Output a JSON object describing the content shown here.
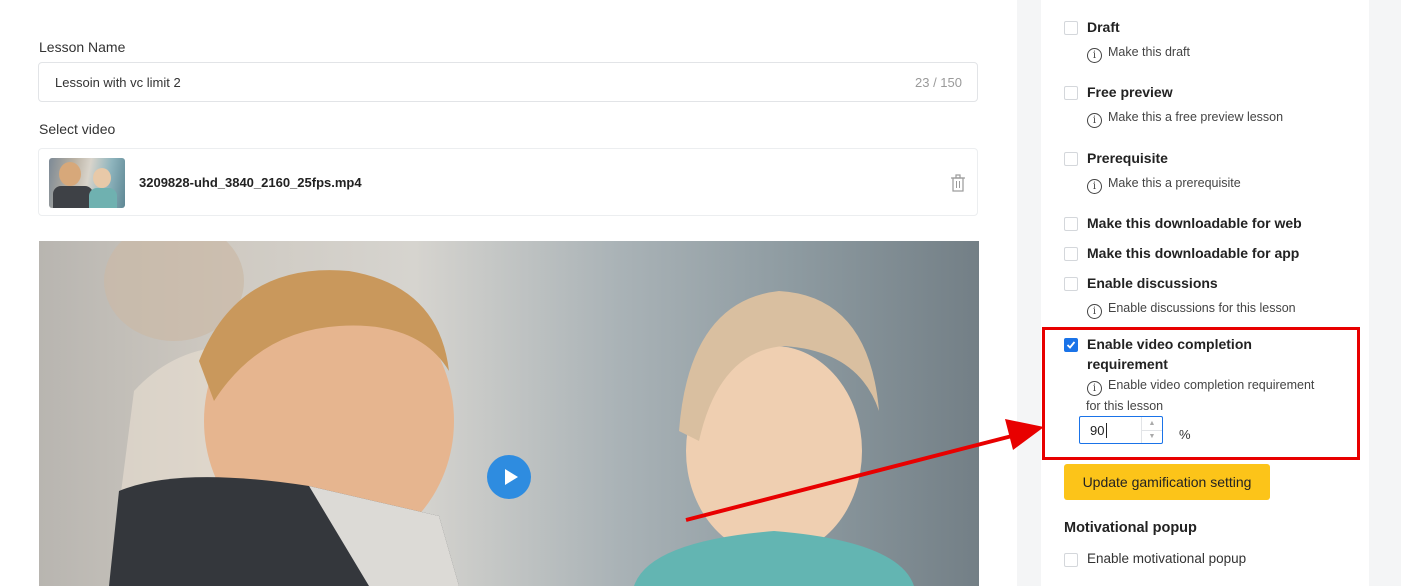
{
  "lesson": {
    "name_label": "Lesson Name",
    "name_value": "Lessoin with vc limit 2",
    "name_count": "23 / 150",
    "select_video_label": "Select video",
    "video_filename": "3209828-uhd_3840_2160_25fps.mp4"
  },
  "sidebar": {
    "options": [
      {
        "label": "Draft",
        "hint": "Make this draft",
        "checked": false
      },
      {
        "label": "Free preview",
        "hint": "Make this a free preview lesson",
        "checked": false
      },
      {
        "label": "Prerequisite",
        "hint": "Make this a prerequisite",
        "checked": false
      },
      {
        "label": "Make this downloadable for web",
        "checked": false
      },
      {
        "label": "Make this downloadable for app",
        "checked": false
      },
      {
        "label": "Enable discussions",
        "hint": "Enable discussions for this lesson",
        "checked": false
      },
      {
        "label_line1": "Enable video completion",
        "label_line2": "requirement",
        "hint_line1": "Enable video completion requirement",
        "hint_line2": "for this lesson",
        "checked": true
      }
    ],
    "completion_value": "90",
    "completion_unit": "%",
    "update_button": "Update gamification setting",
    "motivational_title": "Motivational popup",
    "motivational_option": "Enable motivational popup"
  },
  "colors": {
    "accent": "#1a73e8",
    "play_button": "#2e8ce0",
    "update_button": "#fcc419",
    "annotation": "#e80000"
  },
  "icons": [
    "trash-icon",
    "play-icon",
    "info-icon",
    "check-icon",
    "stepper-up-icon",
    "stepper-down-icon"
  ]
}
